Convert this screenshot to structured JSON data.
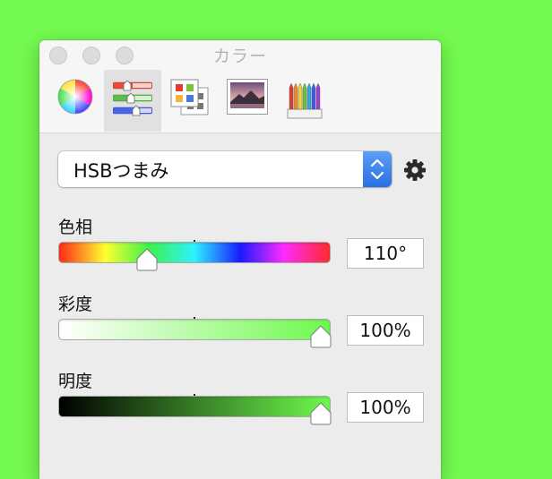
{
  "window": {
    "title": "カラー"
  },
  "toolbar": {
    "tabs": [
      {
        "name": "color-wheel",
        "icon": "color-wheel-icon",
        "selected": false
      },
      {
        "name": "color-sliders",
        "icon": "sliders-icon",
        "selected": true
      },
      {
        "name": "color-palettes",
        "icon": "palettes-icon",
        "selected": false
      },
      {
        "name": "image-palettes",
        "icon": "image-palette-icon",
        "selected": false
      },
      {
        "name": "pencils",
        "icon": "pencils-icon",
        "selected": false
      }
    ]
  },
  "mode_popup": {
    "value": "HSBつまみ",
    "icon": "stepper-icon"
  },
  "settings": {
    "icon": "gear-icon"
  },
  "sliders": [
    {
      "label": "色相",
      "value_text": "110°",
      "value": 110,
      "max": 360
    },
    {
      "label": "彩度",
      "value_text": "100%",
      "value": 100,
      "max": 100
    },
    {
      "label": "明度",
      "value_text": "100%",
      "value": 100,
      "max": 100
    }
  ],
  "colors": {
    "background": "#73f94f",
    "current_color": "#6ef94d",
    "accent": "#2f7ae5"
  }
}
